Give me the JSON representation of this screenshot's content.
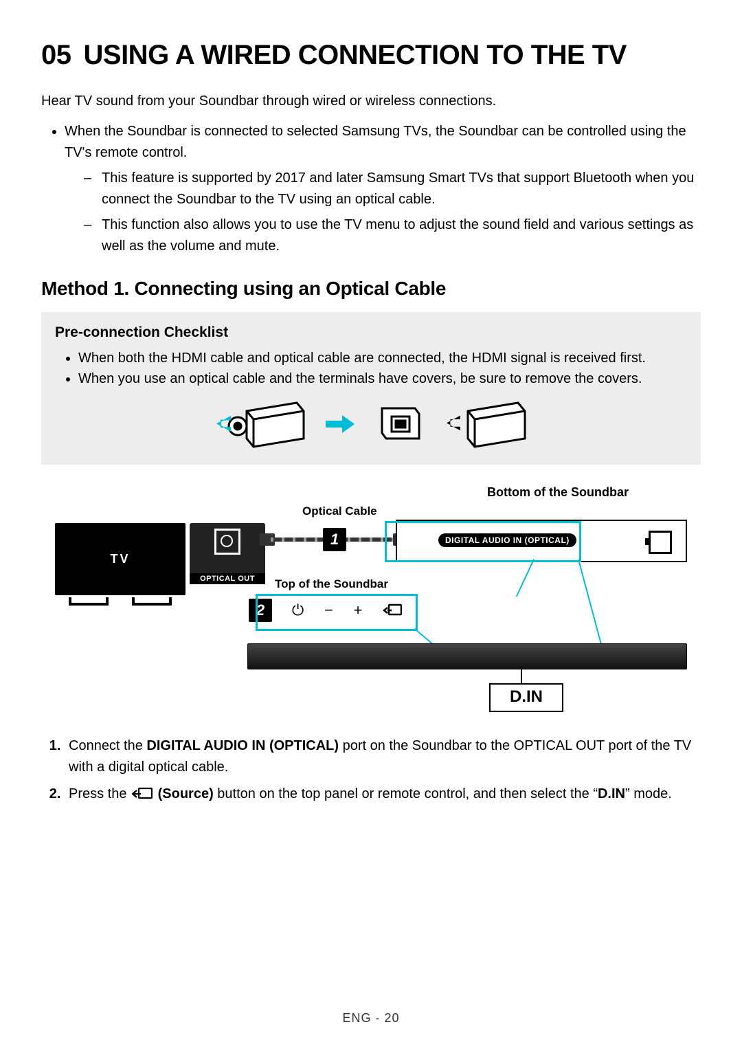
{
  "section": {
    "number": "05",
    "title": "USING A WIRED CONNECTION TO THE TV"
  },
  "intro": "Hear TV sound from your Soundbar through wired or wireless connections.",
  "bullet_main": "When the Soundbar is connected to selected Samsung TVs, the Soundbar can be controlled using the TV's remote control.",
  "dash1": "This feature is supported by 2017 and later Samsung Smart TVs that support Bluetooth when you connect the Soundbar to the TV using an optical cable.",
  "dash2": "This function also allows you to use the TV menu to adjust the sound field and various settings as well as the volume and mute.",
  "method_heading": "Method 1. Connecting using an Optical Cable",
  "checklist": {
    "heading": "Pre-connection Checklist",
    "item1": "When both the HDMI cable and optical cable are connected, the HDMI signal is received first.",
    "item2": "When you use an optical cable and the terminals have covers, be sure to remove the covers."
  },
  "diagram": {
    "bottom_soundbar_label": "Bottom of the Soundbar",
    "optical_cable_label": "Optical Cable",
    "top_soundbar_label": "Top of the Soundbar",
    "tv_label": "TV",
    "optical_out_label": "OPTICAL OUT",
    "digital_audio_in_label": "DIGITAL AUDIO IN (OPTICAL)",
    "step1": "1",
    "step2": "2",
    "din_label": "D.IN",
    "controls": {
      "power": "⏻",
      "minus": "−",
      "plus": "+"
    }
  },
  "steps": {
    "s1_a": "Connect the ",
    "s1_bold": "DIGITAL AUDIO IN (OPTICAL)",
    "s1_b": " port on the Soundbar to the OPTICAL OUT port of the TV with a digital optical cable.",
    "s2_a": "Press the ",
    "s2_source": "(Source)",
    "s2_b": " button on the top panel or remote control, and then select the “",
    "s2_din": "D.IN",
    "s2_c": "” mode."
  },
  "footer": "ENG - 20"
}
